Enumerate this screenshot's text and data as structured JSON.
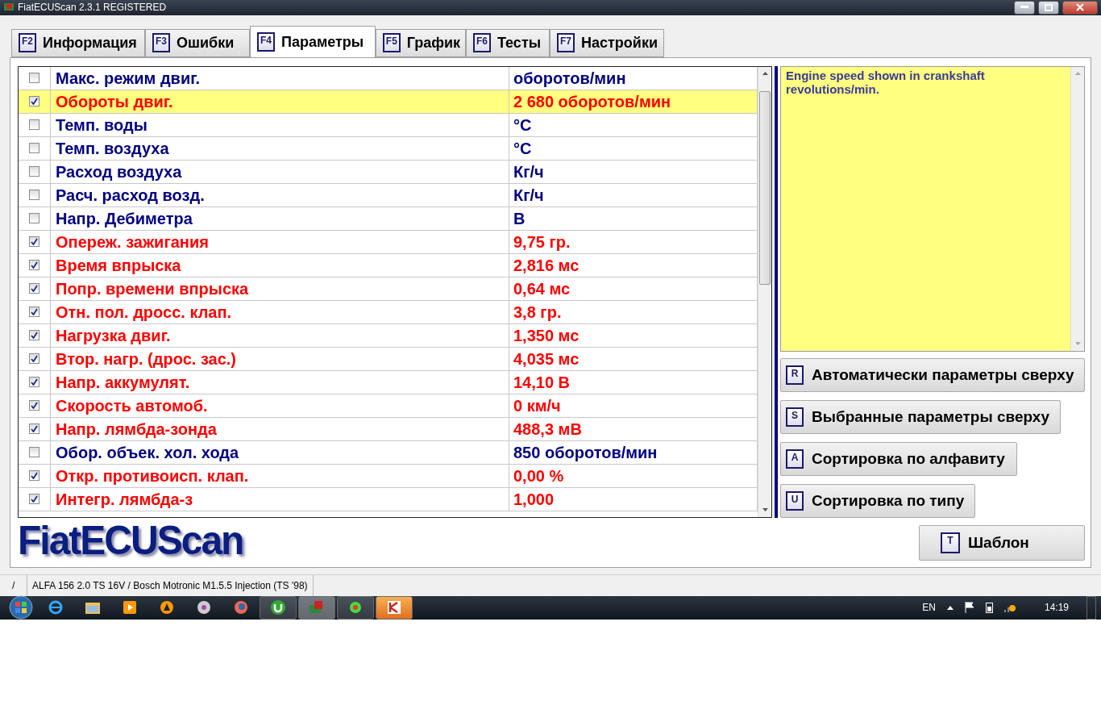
{
  "window": {
    "title": "FiatECUScan 2.3.1 REGISTERED"
  },
  "tabs": [
    {
      "key": "F2",
      "label": "Информация",
      "selected": false
    },
    {
      "key": "F3",
      "label": "Ошибки",
      "selected": false
    },
    {
      "key": "F4",
      "label": "Параметры",
      "selected": true
    },
    {
      "key": "F5",
      "label": "График",
      "selected": false
    },
    {
      "key": "F6",
      "label": "Тесты",
      "selected": false
    },
    {
      "key": "F7",
      "label": "Настройки",
      "selected": false
    }
  ],
  "parameters": [
    {
      "name": "Макс. режим двиг.",
      "value": "оборотов/мин",
      "checked": false,
      "selected": false
    },
    {
      "name": "Обороты двиг.",
      "value": "2 680 оборотов/мин",
      "checked": true,
      "selected": true
    },
    {
      "name": "Темп. воды",
      "value": "°C",
      "checked": false,
      "selected": false
    },
    {
      "name": "Темп. воздуха",
      "value": "°C",
      "checked": false,
      "selected": false
    },
    {
      "name": "Расход воздуха",
      "value": "Кг/ч",
      "checked": false,
      "selected": false
    },
    {
      "name": "Расч. расход возд.",
      "value": "Кг/ч",
      "checked": false,
      "selected": false
    },
    {
      "name": "Напр. Дебиметра",
      "value": "В",
      "checked": false,
      "selected": false
    },
    {
      "name": "Опереж. зажигания",
      "value": "9,75 гр.",
      "checked": true,
      "selected": false
    },
    {
      "name": "Время впрыска",
      "value": "2,816 мс",
      "checked": true,
      "selected": false
    },
    {
      "name": "Попр. времени впрыска",
      "value": "0,64 мс",
      "checked": true,
      "selected": false
    },
    {
      "name": "Отн. пол. дросс. клап.",
      "value": "3,8 гр.",
      "checked": true,
      "selected": false
    },
    {
      "name": "Нагрузка двиг.",
      "value": "1,350 мс",
      "checked": true,
      "selected": false
    },
    {
      "name": "Втор. нагр. (дрос. зас.)",
      "value": "4,035 мс",
      "checked": true,
      "selected": false
    },
    {
      "name": "Напр. аккумулят.",
      "value": "14,10 В",
      "checked": true,
      "selected": false
    },
    {
      "name": "Скорость автомоб.",
      "value": "0 км/ч",
      "checked": true,
      "selected": false
    },
    {
      "name": "Напр. лямбда-зонда",
      "value": "488,3 мВ",
      "checked": true,
      "selected": false
    },
    {
      "name": "Обор. объек. хол. хода",
      "value": "850 оборотов/мин",
      "checked": false,
      "selected": false
    },
    {
      "name": "Откр. противоисп. клап.",
      "value": "0,00 %",
      "checked": true,
      "selected": false
    },
    {
      "name": "Интегр. лямбда-з",
      "value": "1,000",
      "checked": true,
      "selected": false
    }
  ],
  "description": "Engine speed shown in crankshaft revolutions/min.",
  "actions": [
    {
      "key": "R",
      "label": "Автоматически параметры сверху"
    },
    {
      "key": "S",
      "label": "Выбранные параметры сверху"
    },
    {
      "key": "A",
      "label": "Сортировка по алфавиту"
    },
    {
      "key": "U",
      "label": "Сортировка по типу"
    }
  ],
  "template_button": {
    "key": "T",
    "label": "Шаблон"
  },
  "logo": "FiatECUScan",
  "status_bar": [
    "/",
    "ALFA 156 2.0 TS 16V / Bosch Motronic M1.5.5 Injection (TS '98)"
  ],
  "taskbar": {
    "language": "EN",
    "time": "14:19"
  }
}
